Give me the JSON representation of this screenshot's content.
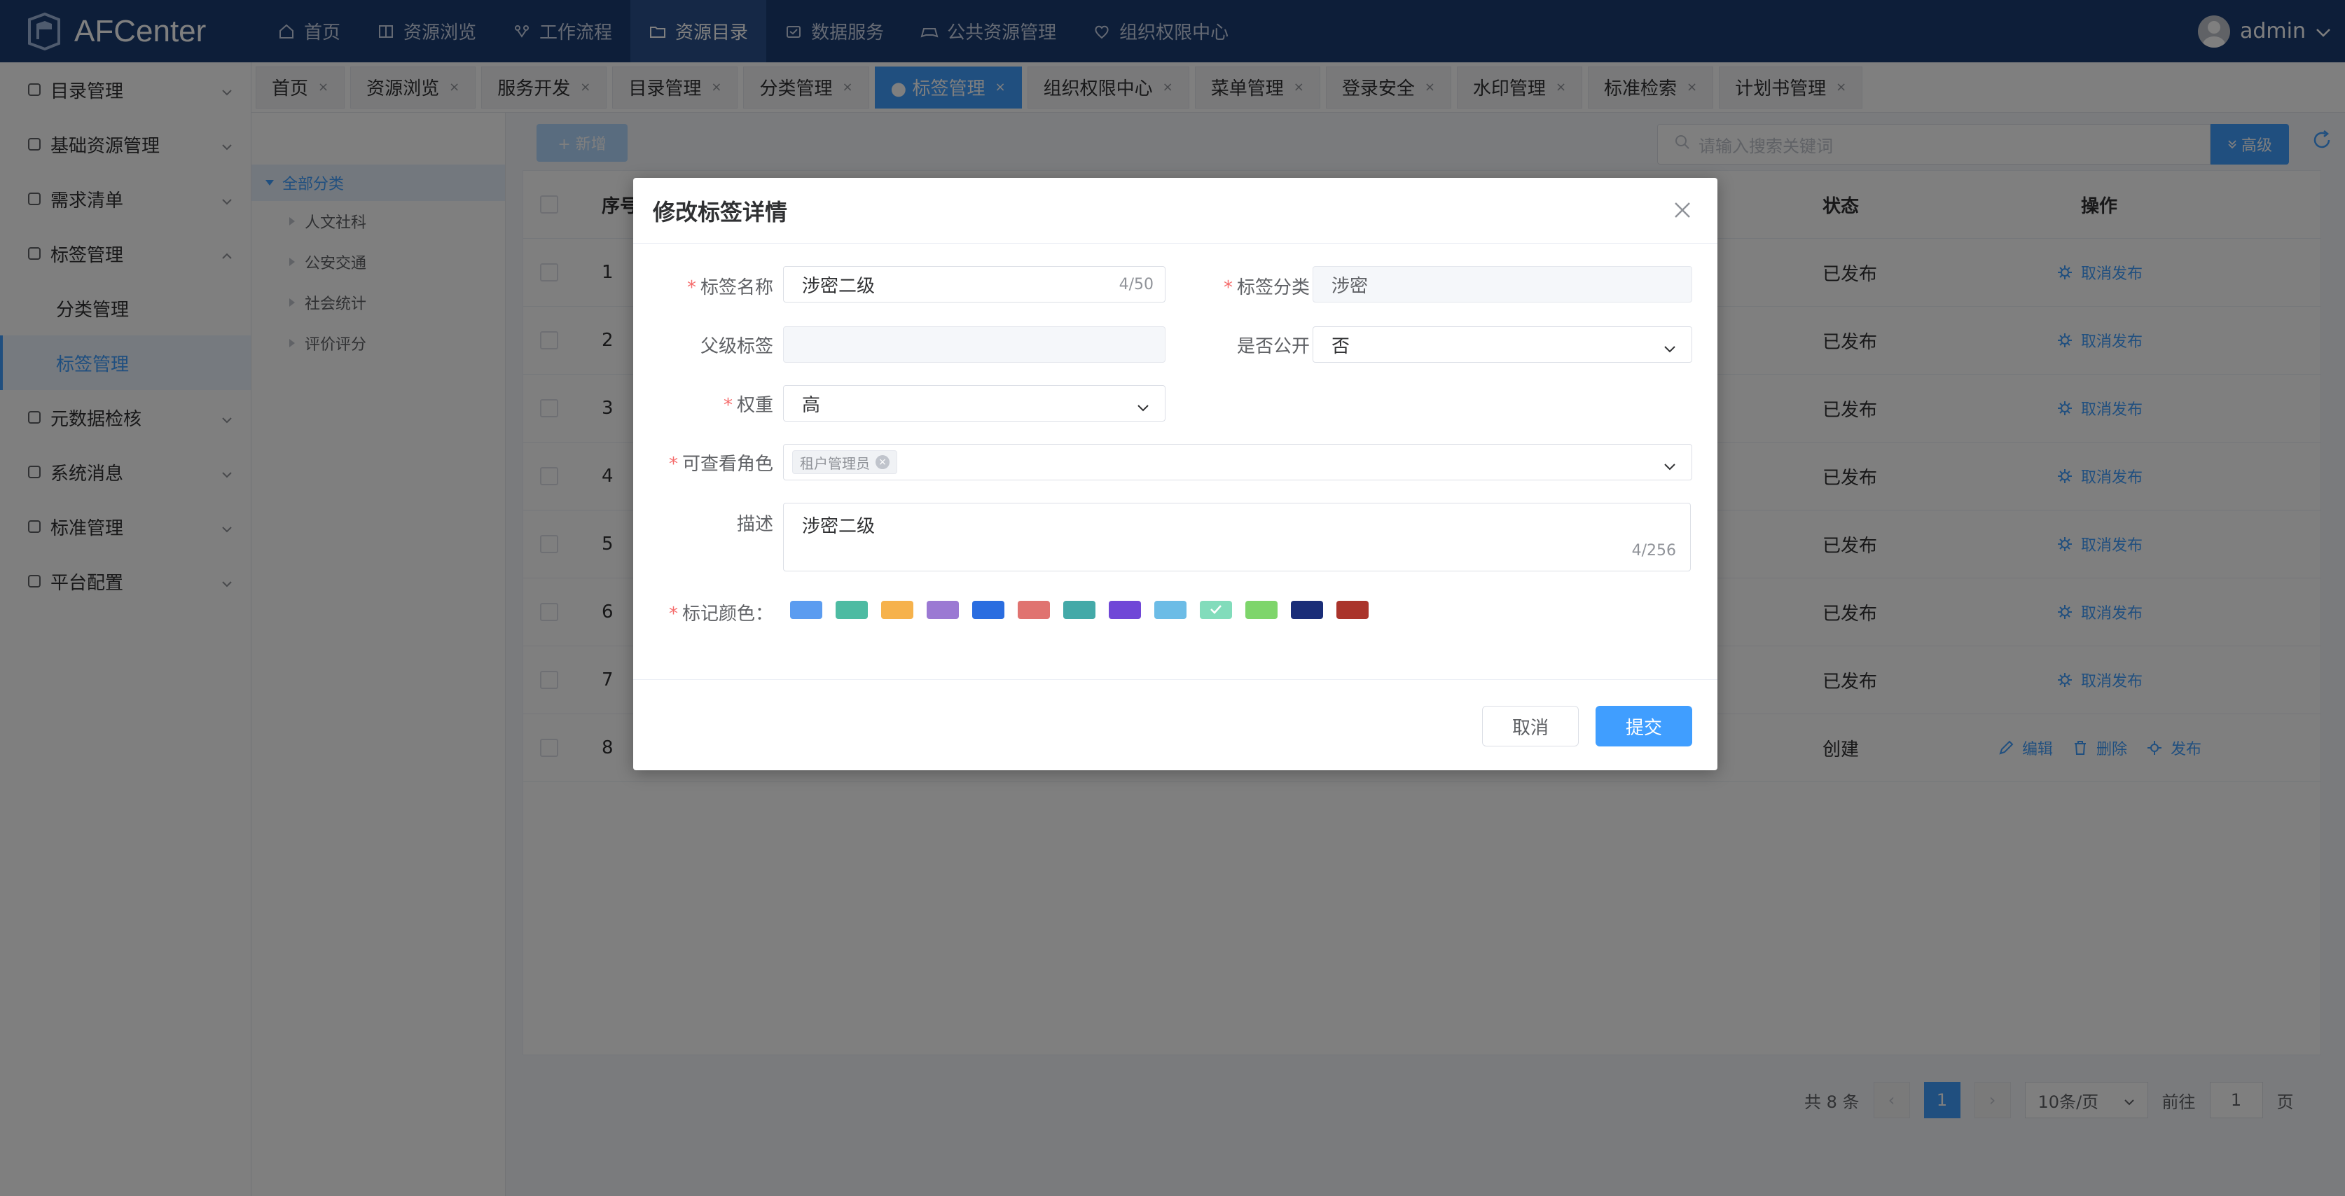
{
  "app": {
    "logo_text": "AFCenter"
  },
  "nav": [
    {
      "label": "首页",
      "icon": "home-icon"
    },
    {
      "label": "资源浏览",
      "icon": "book-icon"
    },
    {
      "label": "工作流程",
      "icon": "flow-icon"
    },
    {
      "label": "资源目录",
      "icon": "folder-icon",
      "active": true
    },
    {
      "label": "数据服务",
      "icon": "service-icon"
    },
    {
      "label": "公共资源管理",
      "icon": "gamepad-icon"
    },
    {
      "label": "组织权限中心",
      "icon": "shield-heart-icon"
    }
  ],
  "user": {
    "name": "admin"
  },
  "sidebar": {
    "items": [
      {
        "label": "目录管理"
      },
      {
        "label": "基础资源管理"
      },
      {
        "label": "需求清单"
      },
      {
        "label": "标签管理",
        "expanded": true
      },
      {
        "label": "元数据检核"
      },
      {
        "label": "系统消息"
      },
      {
        "label": "标准管理"
      },
      {
        "label": "平台配置"
      }
    ],
    "subitems": [
      {
        "label": "分类管理"
      },
      {
        "label": "标签管理",
        "active": true
      }
    ]
  },
  "tabs": [
    {
      "label": "首页"
    },
    {
      "label": "资源浏览"
    },
    {
      "label": "服务开发"
    },
    {
      "label": "目录管理"
    },
    {
      "label": "分类管理"
    },
    {
      "label": "● 标签管理",
      "active": true
    },
    {
      "label": "组织权限中心"
    },
    {
      "label": "菜单管理"
    },
    {
      "label": "登录安全"
    },
    {
      "label": "水印管理"
    },
    {
      "label": "标准检索"
    },
    {
      "label": "计划书管理"
    }
  ],
  "tab_close": "×",
  "tree": {
    "root": "全部分类",
    "nodes": [
      "人文社科",
      "公安交通",
      "社会统计",
      "评价评分"
    ]
  },
  "toolbar": {
    "add_label": "+ 新增",
    "search_placeholder": "请输入搜索关键词",
    "advanced_label": "高级"
  },
  "table": {
    "headers": {
      "index": "序号",
      "status": "状态",
      "ops": "操作"
    },
    "rows": [
      {
        "idx": "1",
        "status": "已发布",
        "ops": [
          "取消发布"
        ]
      },
      {
        "idx": "2",
        "status": "已发布",
        "ops": [
          "取消发布"
        ]
      },
      {
        "idx": "3",
        "status": "已发布",
        "ops": [
          "取消发布"
        ]
      },
      {
        "idx": "4",
        "status": "已发布",
        "ops": [
          "取消发布"
        ]
      },
      {
        "idx": "5",
        "status": "已发布",
        "ops": [
          "取消发布"
        ]
      },
      {
        "idx": "6",
        "status": "已发布",
        "ops": [
          "取消发布"
        ]
      },
      {
        "idx": "7",
        "status": "已发布",
        "ops": [
          "取消发布"
        ]
      },
      {
        "idx": "8",
        "status": "创建",
        "ops": [
          "编辑",
          "删除",
          "发布"
        ]
      }
    ]
  },
  "pager": {
    "total": "共 8 条",
    "current": "1",
    "page_size": "10条/页",
    "goto_prefix": "前往",
    "goto_value": "1",
    "goto_suffix": "页",
    "prev": "‹",
    "next": "›"
  },
  "modal": {
    "title": "修改标签详情",
    "fields": {
      "name_label": "标签名称",
      "name_value": "涉密二级",
      "name_counter": "4/50",
      "category_label": "标签分类",
      "category_value": "涉密",
      "parent_label": "父级标签",
      "parent_value": "",
      "public_label": "是否公开",
      "public_value": "否",
      "weight_label": "权重",
      "weight_value": "高",
      "roles_label": "可查看角色",
      "roles": [
        "租户管理员"
      ],
      "desc_label": "描述",
      "desc_value": "涉密二级",
      "desc_counter": "4/256",
      "color_label": "标记颜色："
    },
    "colors": [
      "#5b9cf0",
      "#4dbba2",
      "#f6b24c",
      "#9b79d3",
      "#2a6de0",
      "#e07370",
      "#43a9a8",
      "#7047d7",
      "#6cbce6",
      "#82dcbb",
      "#7ed56b",
      "#1a2d78",
      "#aa342b"
    ],
    "selected_color_index": 9,
    "cancel_label": "取消",
    "submit_label": "提交"
  }
}
